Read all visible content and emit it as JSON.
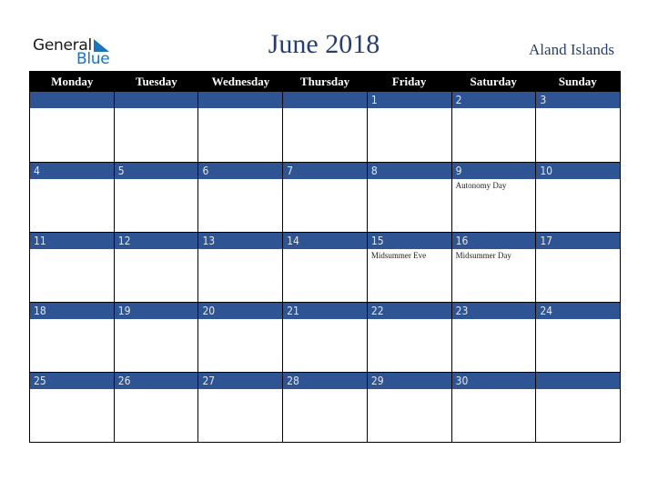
{
  "logo": {
    "word1": "General",
    "word2": "Blue",
    "brand_color": "#1b75bc"
  },
  "title": "June 2018",
  "country": "Aland Islands",
  "colors": {
    "header_bg": "#000000",
    "band_bg": "#2e5494",
    "title_color": "#253f6e"
  },
  "weekdays": [
    "Monday",
    "Tuesday",
    "Wednesday",
    "Thursday",
    "Friday",
    "Saturday",
    "Sunday"
  ],
  "weeks": [
    [
      {
        "day": "",
        "holiday": ""
      },
      {
        "day": "",
        "holiday": ""
      },
      {
        "day": "",
        "holiday": ""
      },
      {
        "day": "",
        "holiday": ""
      },
      {
        "day": "1",
        "holiday": ""
      },
      {
        "day": "2",
        "holiday": ""
      },
      {
        "day": "3",
        "holiday": ""
      }
    ],
    [
      {
        "day": "4",
        "holiday": ""
      },
      {
        "day": "5",
        "holiday": ""
      },
      {
        "day": "6",
        "holiday": ""
      },
      {
        "day": "7",
        "holiday": ""
      },
      {
        "day": "8",
        "holiday": ""
      },
      {
        "day": "9",
        "holiday": "Autonomy Day"
      },
      {
        "day": "10",
        "holiday": ""
      }
    ],
    [
      {
        "day": "11",
        "holiday": ""
      },
      {
        "day": "12",
        "holiday": ""
      },
      {
        "day": "13",
        "holiday": ""
      },
      {
        "day": "14",
        "holiday": ""
      },
      {
        "day": "15",
        "holiday": "Midsummer Eve"
      },
      {
        "day": "16",
        "holiday": "Midsummer Day"
      },
      {
        "day": "17",
        "holiday": ""
      }
    ],
    [
      {
        "day": "18",
        "holiday": ""
      },
      {
        "day": "19",
        "holiday": ""
      },
      {
        "day": "20",
        "holiday": ""
      },
      {
        "day": "21",
        "holiday": ""
      },
      {
        "day": "22",
        "holiday": ""
      },
      {
        "day": "23",
        "holiday": ""
      },
      {
        "day": "24",
        "holiday": ""
      }
    ],
    [
      {
        "day": "25",
        "holiday": ""
      },
      {
        "day": "26",
        "holiday": ""
      },
      {
        "day": "27",
        "holiday": ""
      },
      {
        "day": "28",
        "holiday": ""
      },
      {
        "day": "29",
        "holiday": ""
      },
      {
        "day": "30",
        "holiday": ""
      },
      {
        "day": "",
        "holiday": ""
      }
    ]
  ]
}
